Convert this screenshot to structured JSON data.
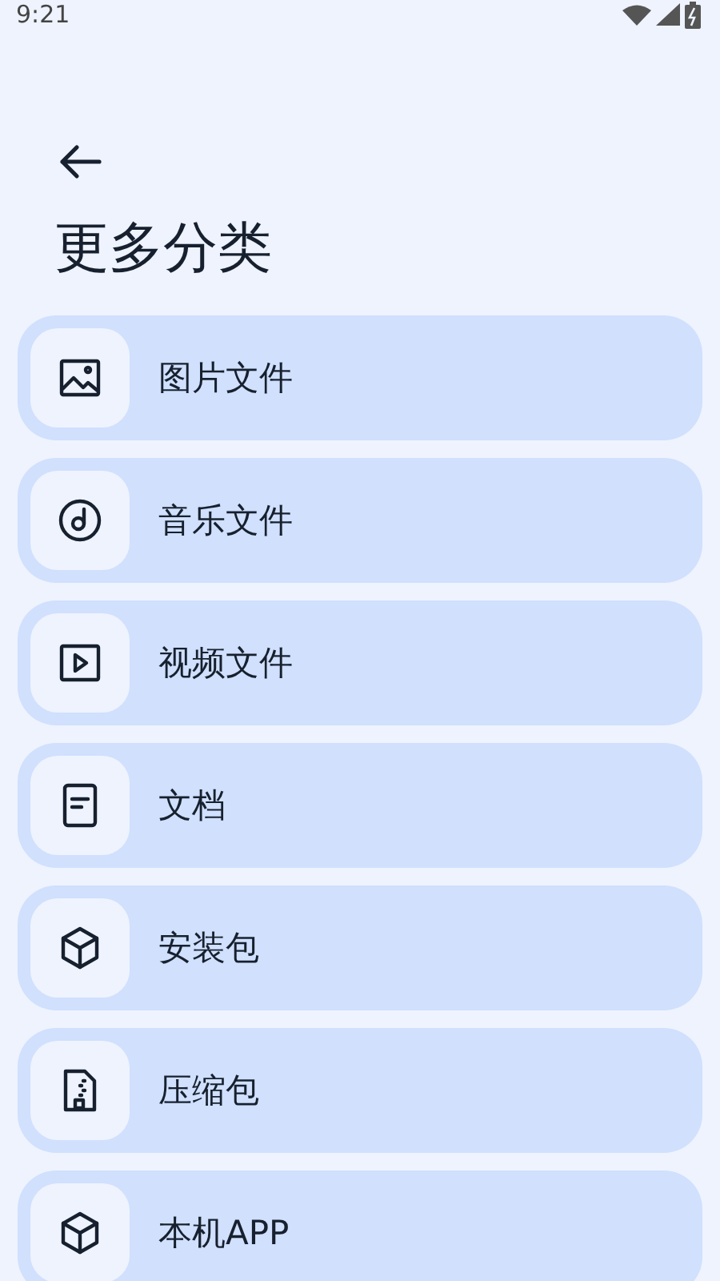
{
  "status_bar": {
    "time": "9:21"
  },
  "title": "更多分类",
  "categories": [
    {
      "kind": "image",
      "label": "图片文件"
    },
    {
      "kind": "music",
      "label": "音乐文件"
    },
    {
      "kind": "video",
      "label": "视频文件"
    },
    {
      "kind": "document",
      "label": "文档"
    },
    {
      "kind": "package",
      "label": "安装包"
    },
    {
      "kind": "archive",
      "label": "压缩包"
    },
    {
      "kind": "package",
      "label": "本机APP"
    }
  ]
}
